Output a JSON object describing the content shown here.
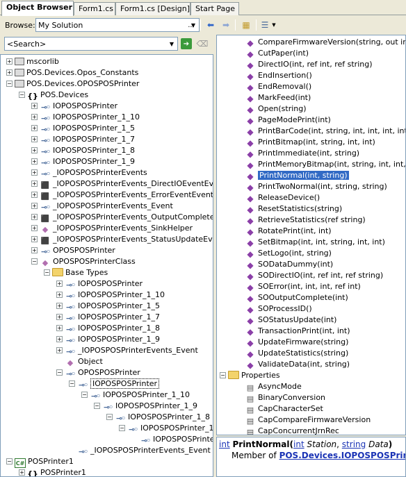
{
  "tabs": [
    "Object Browser",
    "Form1.cs",
    "Form1.cs [Design]",
    "Start Page"
  ],
  "toolbar": {
    "browse_label": "Browse:",
    "browse_value": "My Solution",
    "more": "..."
  },
  "search": {
    "placeholder": "<Search>"
  },
  "left_tree": [
    {
      "indent": 0,
      "exp": "+",
      "icon": "library",
      "label": "mscorlib"
    },
    {
      "indent": 0,
      "exp": "+",
      "icon": "library",
      "label": "POS.Devices.Opos_Constants"
    },
    {
      "indent": 0,
      "exp": "-",
      "icon": "library",
      "label": "POS.Devices.OPOSPOSPrinter"
    },
    {
      "indent": 1,
      "exp": "-",
      "icon": "namespace",
      "label": "POS.Devices"
    },
    {
      "indent": 2,
      "exp": "+",
      "icon": "interface",
      "label": "IOPOSPOSPrinter"
    },
    {
      "indent": 2,
      "exp": "+",
      "icon": "interface",
      "label": "IOPOSPOSPrinter_1_10"
    },
    {
      "indent": 2,
      "exp": "+",
      "icon": "interface",
      "label": "IOPOSPOSPrinter_1_5"
    },
    {
      "indent": 2,
      "exp": "+",
      "icon": "interface",
      "label": "IOPOSPOSPrinter_1_7"
    },
    {
      "indent": 2,
      "exp": "+",
      "icon": "interface",
      "label": "IOPOSPOSPrinter_1_8"
    },
    {
      "indent": 2,
      "exp": "+",
      "icon": "interface",
      "label": "IOPOSPOSPrinter_1_9"
    },
    {
      "indent": 2,
      "exp": "+",
      "icon": "interface",
      "label": "_IOPOSPOSPrinterEvents"
    },
    {
      "indent": 2,
      "exp": "+",
      "icon": "delegate",
      "label": "_IOPOSPOSPrinterEvents_DirectIOEventEvent"
    },
    {
      "indent": 2,
      "exp": "+",
      "icon": "delegate",
      "label": "_IOPOSPOSPrinterEvents_ErrorEventEventHandler"
    },
    {
      "indent": 2,
      "exp": "+",
      "icon": "interface",
      "label": "_IOPOSPOSPrinterEvents_Event"
    },
    {
      "indent": 2,
      "exp": "+",
      "icon": "delegate",
      "label": "_IOPOSPOSPrinterEvents_OutputCompleteEventHandler"
    },
    {
      "indent": 2,
      "exp": "+",
      "icon": "class",
      "label": "_IOPOSPOSPrinterEvents_SinkHelper"
    },
    {
      "indent": 2,
      "exp": "+",
      "icon": "delegate",
      "label": "_IOPOSPOSPrinterEvents_StatusUpdateEventHandler"
    },
    {
      "indent": 2,
      "exp": "+",
      "icon": "interface",
      "label": "OPOSPOSPrinter"
    },
    {
      "indent": 2,
      "exp": "-",
      "icon": "class",
      "label": "OPOSPOSPrinterClass"
    },
    {
      "indent": 3,
      "exp": "-",
      "icon": "folder",
      "label": "Base Types"
    },
    {
      "indent": 4,
      "exp": "+",
      "icon": "interface",
      "label": "IOPOSPOSPrinter"
    },
    {
      "indent": 4,
      "exp": "+",
      "icon": "interface",
      "label": "IOPOSPOSPrinter_1_10"
    },
    {
      "indent": 4,
      "exp": "+",
      "icon": "interface",
      "label": "IOPOSPOSPrinter_1_5"
    },
    {
      "indent": 4,
      "exp": "+",
      "icon": "interface",
      "label": "IOPOSPOSPrinter_1_7"
    },
    {
      "indent": 4,
      "exp": "+",
      "icon": "interface",
      "label": "IOPOSPOSPrinter_1_8"
    },
    {
      "indent": 4,
      "exp": "+",
      "icon": "interface",
      "label": "IOPOSPOSPrinter_1_9"
    },
    {
      "indent": 4,
      "exp": "+",
      "icon": "interface",
      "label": "_IOPOSPOSPrinterEvents_Event"
    },
    {
      "indent": 4,
      "exp": "",
      "icon": "class",
      "label": "Object"
    },
    {
      "indent": 4,
      "exp": "-",
      "icon": "interface",
      "label": "OPOSPOSPrinter"
    },
    {
      "indent": 5,
      "exp": "-",
      "icon": "interface",
      "label": "IOPOSPOSPrinter",
      "selected": true
    },
    {
      "indent": 6,
      "exp": "-",
      "icon": "interface",
      "label": "IOPOSPOSPrinter_1_10"
    },
    {
      "indent": 7,
      "exp": "-",
      "icon": "interface",
      "label": "IOPOSPOSPrinter_1_9"
    },
    {
      "indent": 8,
      "exp": "-",
      "icon": "interface",
      "label": "IOPOSPOSPrinter_1_8"
    },
    {
      "indent": 9,
      "exp": "-",
      "icon": "interface",
      "label": "IOPOSPOSPrinter_1_7"
    },
    {
      "indent": 10,
      "exp": "",
      "icon": "interface",
      "label": "IOPOSPOSPrinter_1_5"
    },
    {
      "indent": 5,
      "exp": "",
      "icon": "interface",
      "label": "_IOPOSPOSPrinterEvents_Event"
    },
    {
      "indent": 0,
      "exp": "-",
      "icon": "project",
      "label": "POSPrinter1"
    },
    {
      "indent": 1,
      "exp": "+",
      "icon": "namespace",
      "label": "POSPrinter1"
    }
  ],
  "members": [
    {
      "type": "method",
      "label": "CompareFirmwareVersion(string, out int)"
    },
    {
      "type": "method",
      "label": "CutPaper(int)"
    },
    {
      "type": "method",
      "label": "DirectIO(int, ref int, ref string)"
    },
    {
      "type": "method",
      "label": "EndInsertion()"
    },
    {
      "type": "method",
      "label": "EndRemoval()"
    },
    {
      "type": "method",
      "label": "MarkFeed(int)"
    },
    {
      "type": "method",
      "label": "Open(string)"
    },
    {
      "type": "method",
      "label": "PageModePrint(int)"
    },
    {
      "type": "method",
      "label": "PrintBarCode(int, string, int, int, int, int, int)"
    },
    {
      "type": "method",
      "label": "PrintBitmap(int, string, int, int)"
    },
    {
      "type": "method",
      "label": "PrintImmediate(int, string)"
    },
    {
      "type": "method",
      "label": "PrintMemoryBitmap(int, string, int, int, int)"
    },
    {
      "type": "method",
      "label": "PrintNormal(int, string)",
      "selected": true
    },
    {
      "type": "method",
      "label": "PrintTwoNormal(int, string, string)"
    },
    {
      "type": "method",
      "label": "ReleaseDevice()"
    },
    {
      "type": "method",
      "label": "ResetStatistics(string)"
    },
    {
      "type": "method",
      "label": "RetrieveStatistics(ref string)"
    },
    {
      "type": "method",
      "label": "RotatePrint(int, int)"
    },
    {
      "type": "method",
      "label": "SetBitmap(int, int, string, int, int)"
    },
    {
      "type": "method",
      "label": "SetLogo(int, string)"
    },
    {
      "type": "method",
      "label": "SODataDummy(int)"
    },
    {
      "type": "method",
      "label": "SODirectIO(int, ref int, ref string)"
    },
    {
      "type": "method",
      "label": "SOError(int, int, int, ref int)"
    },
    {
      "type": "method",
      "label": "SOOutputComplete(int)"
    },
    {
      "type": "method",
      "label": "SOProcessID()"
    },
    {
      "type": "method",
      "label": "SOStatusUpdate(int)"
    },
    {
      "type": "method",
      "label": "TransactionPrint(int, int)"
    },
    {
      "type": "method",
      "label": "UpdateFirmware(string)"
    },
    {
      "type": "method",
      "label": "UpdateStatistics(string)"
    },
    {
      "type": "method",
      "label": "ValidateData(int, string)"
    },
    {
      "type": "folder",
      "label": "Properties"
    },
    {
      "type": "property",
      "label": "AsyncMode"
    },
    {
      "type": "property",
      "label": "BinaryConversion"
    },
    {
      "type": "property",
      "label": "CapCharacterSet"
    },
    {
      "type": "property",
      "label": "CapCompareFirmwareVersion"
    },
    {
      "type": "property",
      "label": "CapConcurrentJrnRec"
    }
  ],
  "description": {
    "ret_type": "int",
    "name": "PrintNormal(",
    "p1_type": "int",
    "p1_name": "Station",
    "comma": ", ",
    "p2_type": "string",
    "p2_name": "Data",
    "close": ")",
    "member_of": "Member of ",
    "member_link": "POS.Devices.IOPOSPOSPrinter"
  }
}
